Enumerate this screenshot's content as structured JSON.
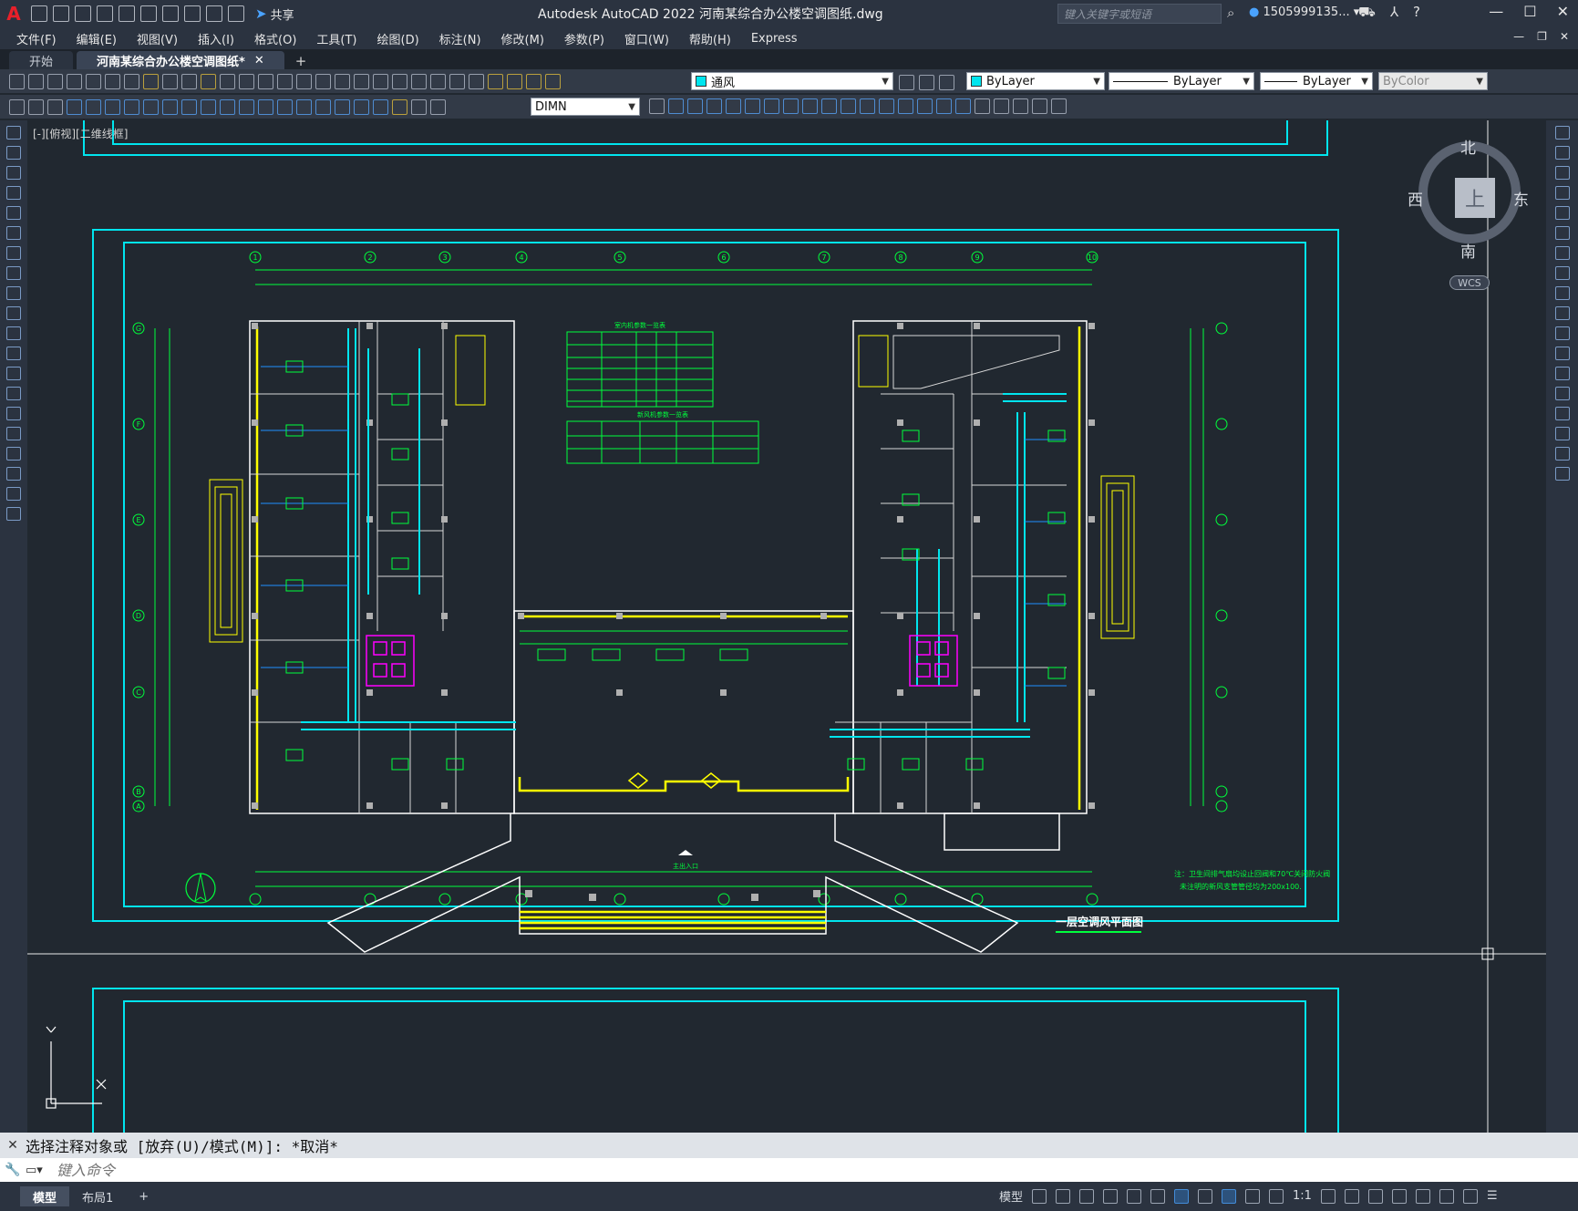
{
  "app": {
    "logo": "A",
    "title": "Autodesk AutoCAD 2022    河南某综合办公楼空调图纸.dwg",
    "share_label": "共享",
    "search_placeholder": "键入关键字或短语",
    "user": "1505999135..."
  },
  "menu": {
    "items": [
      "文件(F)",
      "编辑(E)",
      "视图(V)",
      "插入(I)",
      "格式(O)",
      "工具(T)",
      "绘图(D)",
      "标注(N)",
      "修改(M)",
      "参数(P)",
      "窗口(W)",
      "帮助(H)",
      "Express"
    ]
  },
  "tabs": {
    "start": "开始",
    "active": "河南某综合办公楼空调图纸*",
    "add": "+"
  },
  "toolbar": {
    "layer": "通风",
    "color": "ByLayer",
    "linetype": "ByLayer",
    "lineweight": "ByLayer",
    "plotstyle": "ByColor",
    "dimstyle": "DIMN"
  },
  "viewport": {
    "label": "[-][俯视][二维线框]"
  },
  "viewcube": {
    "north": "北",
    "south": "南",
    "east": "东",
    "west": "西",
    "top": "上",
    "wcs": "WCS"
  },
  "drawing": {
    "title": "一层空调风平面图",
    "note_line1": "注：卫生间排气扇均设止回阀和70℃关闭防火阀",
    "note_line2": "未注明的新风支管管径均为200x100.",
    "table1_title": "室内机参数一览表",
    "table2_title": "新风机参数一览表",
    "entrance_label": "主出入口",
    "axis_labels_top": [
      "1",
      "2",
      "3",
      "4",
      "5",
      "6",
      "7",
      "8",
      "9",
      "10"
    ],
    "axis_labels_side": [
      "G",
      "F",
      "E",
      "D",
      "C",
      "B",
      "A"
    ]
  },
  "command": {
    "history": "选择注释对象或 [放弃(U)/模式(M)]: *取消*",
    "placeholder": "键入命令"
  },
  "status": {
    "model_tab": "模型",
    "layout_tab": "布局1",
    "add": "+",
    "model_btn": "模型",
    "scale": "1:1"
  },
  "colors": {
    "cyan": "#00e5ee",
    "green": "#00ff3c",
    "yellow": "#ffff00",
    "magenta": "#ff00ff",
    "white": "#ffffff",
    "blue": "#1e8fff"
  }
}
